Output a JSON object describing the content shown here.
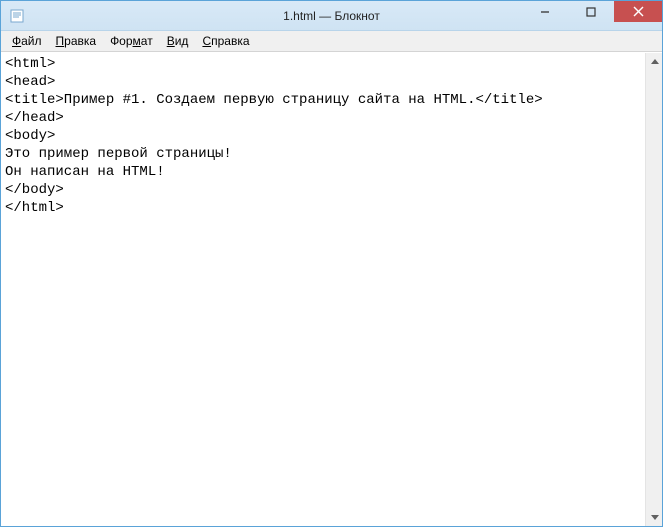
{
  "window": {
    "title": "1.html — Блокнот"
  },
  "menu": {
    "file": "Файл",
    "edit": "Правка",
    "format": "Формат",
    "view": "Вид",
    "help": "Справка"
  },
  "editor": {
    "content": "<html>\n<head>\n<title>Пример #1. Создаем первую страницу сайта на HTML.</title>\n</head>\n<body>\nЭто пример первой страницы!\nОн написан на HTML!\n</body>\n</html>"
  }
}
